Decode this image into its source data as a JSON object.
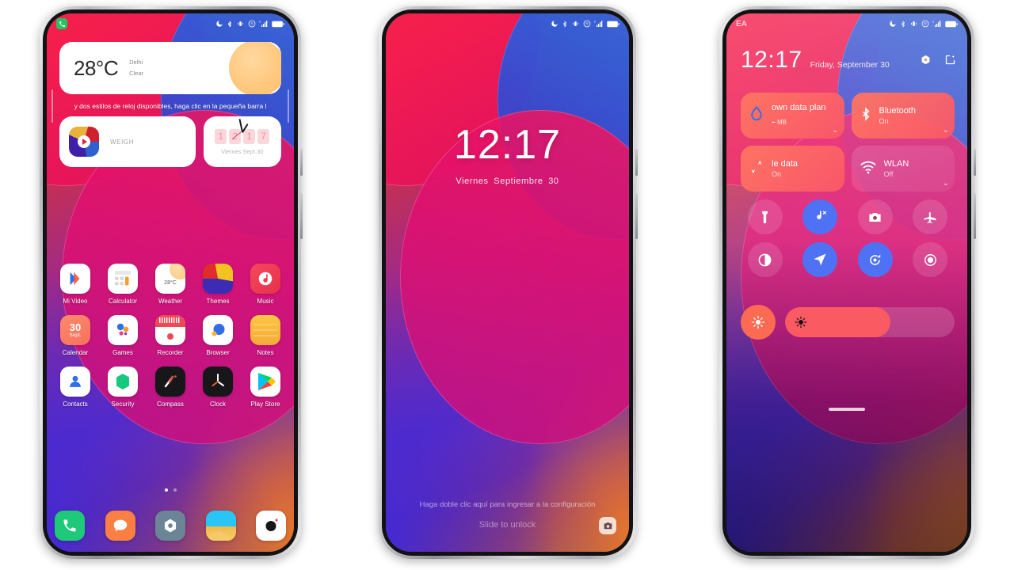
{
  "statusbar": {
    "icons": [
      "dnd-moon-icon",
      "bluetooth-icon",
      "vibrate-icon",
      "roaming-icon",
      "signal-bars-icon",
      "battery-icon"
    ],
    "notification_icon": "phone-call-icon",
    "carrier": "EA"
  },
  "home": {
    "weather_widget": {
      "temperature": "28°C",
      "city": "Delhi",
      "condition": "Clear"
    },
    "hint_bar": {
      "text": "y dos estilos de reloj disponibles, haga clic en la pequeña barra l"
    },
    "weigh_widget": {
      "label": "WEIGH"
    },
    "clock_widget": {
      "digits": [
        "1",
        "2",
        "1",
        "7"
      ],
      "date": "Viernes Sept.30"
    },
    "apps": [
      [
        {
          "label": "Mi Video",
          "icon": "mi-video-icon"
        },
        {
          "label": "Calculator",
          "icon": "calculator-icon"
        },
        {
          "label": "Weather",
          "icon": "weather-icon",
          "badge": "28°C"
        },
        {
          "label": "Themes",
          "icon": "themes-icon"
        },
        {
          "label": "Music",
          "icon": "music-icon"
        }
      ],
      [
        {
          "label": "Calendar",
          "icon": "calendar-icon",
          "day": "30",
          "month": "Sept."
        },
        {
          "label": "Games",
          "icon": "games-icon"
        },
        {
          "label": "Recorder",
          "icon": "recorder-icon"
        },
        {
          "label": "Browser",
          "icon": "browser-icon"
        },
        {
          "label": "Notes",
          "icon": "notes-icon"
        }
      ],
      [
        {
          "label": "Contacts",
          "icon": "contacts-icon"
        },
        {
          "label": "Security",
          "icon": "security-icon"
        },
        {
          "label": "Compass",
          "icon": "compass-icon"
        },
        {
          "label": "Clock",
          "icon": "clock-icon"
        },
        {
          "label": "Play Store",
          "icon": "play-store-icon"
        }
      ]
    ],
    "page_dots": {
      "count": 2,
      "active_index": 0
    },
    "dock": [
      {
        "label": "Phone",
        "icon": "phone-icon"
      },
      {
        "label": "Messages",
        "icon": "messages-icon"
      },
      {
        "label": "Settings",
        "icon": "settings-icon"
      },
      {
        "label": "Gallery",
        "icon": "gallery-icon"
      },
      {
        "label": "Camera",
        "icon": "camera-icon"
      }
    ]
  },
  "lockscreen": {
    "time": "12:17",
    "date": "Viernes  Septiembre  30",
    "hint": "Haga doble clic aquí para ingresar a la configuración",
    "slide_text": "Slide to unlock",
    "camera_shortcut": "camera-icon"
  },
  "controlcenter": {
    "time": "12:17",
    "date": "Friday, September 30",
    "header_actions": [
      {
        "name": "settings-gear-icon"
      },
      {
        "name": "screenshot-icon"
      }
    ],
    "tiles": [
      {
        "title": "own data plan",
        "sub": "--",
        "unit": "MB",
        "state": "on",
        "icon": "data-drop-icon"
      },
      {
        "title": "Bluetooth",
        "sub": "On",
        "state": "on",
        "icon": "bluetooth-icon"
      },
      {
        "title": "le data",
        "sub": "On",
        "state": "on",
        "icon": "mobile-data-icon"
      },
      {
        "title": "WLAN",
        "sub": "Off",
        "state": "off",
        "icon": "wifi-icon"
      }
    ],
    "toggles": [
      {
        "name": "flashlight-icon",
        "state": "off"
      },
      {
        "name": "silent-mode-icon",
        "state": "on"
      },
      {
        "name": "camera-icon",
        "state": "off"
      },
      {
        "name": "airplane-mode-icon",
        "state": "off"
      },
      {
        "name": "dark-mode-icon",
        "state": "off"
      },
      {
        "name": "location-icon",
        "state": "on"
      },
      {
        "name": "auto-rotate-icon",
        "state": "on"
      },
      {
        "name": "screen-record-icon",
        "state": "off"
      }
    ],
    "brightness": {
      "auto_icon": "auto-brightness-icon",
      "slider_icon": "brightness-icon",
      "percent": 62
    },
    "accent_colors": {
      "tile_on": "#fa5866",
      "toggle_on": "#4f72f5",
      "auto_brightness": "#fb6a52"
    }
  }
}
